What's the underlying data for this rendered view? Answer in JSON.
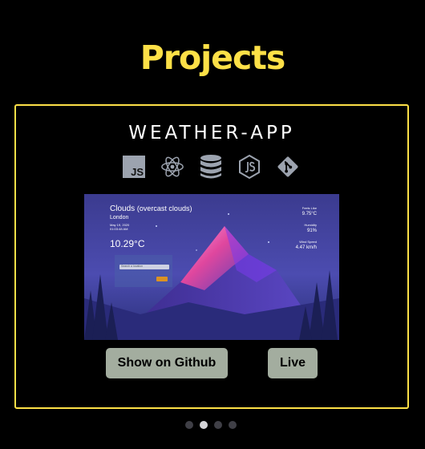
{
  "section": {
    "title": "Projects"
  },
  "project": {
    "title": "WEATHER-APP",
    "tech_icons": [
      "javascript-icon",
      "react-icon",
      "database-icon",
      "nodejs-icon",
      "git-icon"
    ],
    "tech_labels": {
      "javascript": "JS"
    },
    "preview": {
      "condition": "Clouds",
      "description": "(overcast clouds)",
      "city": "London",
      "date": "May 19, 2020",
      "time": "01:03:48 AM",
      "temperature": "10.29°C",
      "search_placeholder": "Search a location",
      "feels_like_label": "Feels Like",
      "feels_like_value": "9.75°C",
      "humidity_label": "Humidity",
      "humidity_value": "91%",
      "wind_label": "Wind Speed",
      "wind_value": "4.47 km/h"
    },
    "buttons": {
      "github": "Show on Github",
      "live": "Live"
    }
  },
  "carousel": {
    "count": 4,
    "active_index": 1
  },
  "colors": {
    "accent": "#fde047",
    "button_bg": "#a3ad9f",
    "icon_gray": "#9ca3af",
    "dot_inactive": "#3f3f46",
    "dot_active": "#d4d4d8"
  }
}
